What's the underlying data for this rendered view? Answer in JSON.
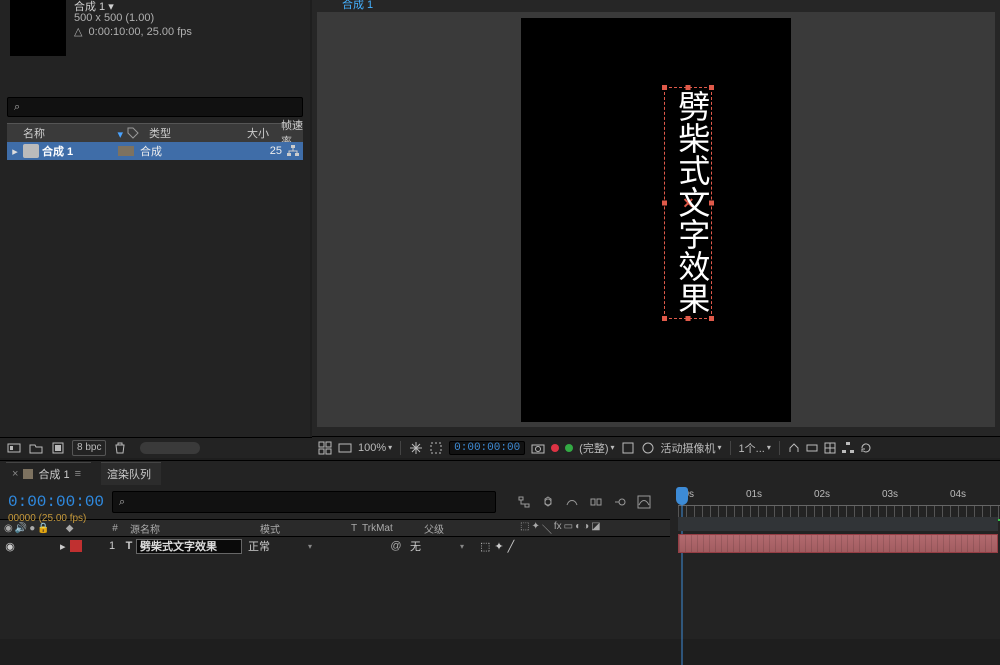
{
  "project": {
    "comp_title": "合成 1",
    "comp_dims": "500 x 500 (1.00)",
    "comp_duration": "0:00:10:00, 25.00 fps",
    "search_icon": "⌕",
    "columns": {
      "name": "名称",
      "type": "类型",
      "size": "大小",
      "fps": "帧速率"
    },
    "row": {
      "name": "合成 1",
      "type": "合成",
      "fps": "25"
    },
    "bpc_label": "8 bpc"
  },
  "viewer": {
    "tab": "合成 1",
    "text": "劈柴式文字效果",
    "footer": {
      "zoom": "100%",
      "timecode": "0:00:00:00",
      "resolution": "(完整)",
      "camera": "活动摄像机",
      "views": "1个..."
    }
  },
  "timeline": {
    "tab1": "合成 1",
    "tab2": "渲染队列",
    "timecode": "0:00:00:00",
    "frames": "00000 (25.00 fps)",
    "columns": {
      "idx": "#",
      "source": "源名称",
      "mode": "模式",
      "t": "T",
      "trkmat": "TrkMat",
      "parent": "父级"
    },
    "layer": {
      "index": "1",
      "type": "T",
      "name": "劈柴式文字效果",
      "mode": "正常",
      "parent": "无"
    },
    "ruler": [
      "00s",
      "01s",
      "02s",
      "03s",
      "04s"
    ]
  }
}
